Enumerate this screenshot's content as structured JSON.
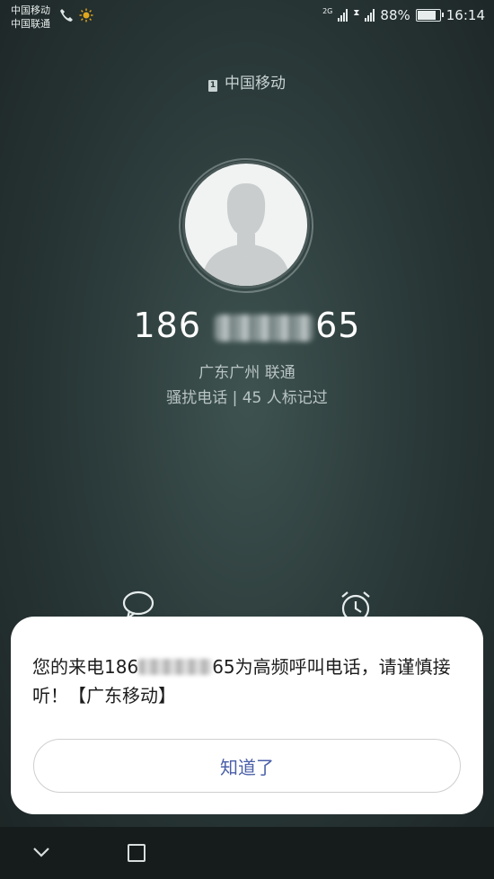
{
  "status_bar": {
    "carrier1": "中国移动",
    "carrier2": "中国联通",
    "network_type": "2G",
    "battery_percent": "88%",
    "time": "16:14",
    "battery_level": 0.88
  },
  "call": {
    "sim_label": "中国移动",
    "sim_slot": "1",
    "number_prefix": "186",
    "number_suffix": "65",
    "location": "广东广州 联通",
    "tag_info": "骚扰电话 | 45 人标记过"
  },
  "dialog": {
    "message_part1": "您的来电186",
    "message_part2": "65为高频呼叫电话，请谨慎接听！【广东移动】",
    "confirm_label": "知道了"
  },
  "colors": {
    "dialog_button_text": "#4a5fa8",
    "background": "#2b3a3a"
  }
}
